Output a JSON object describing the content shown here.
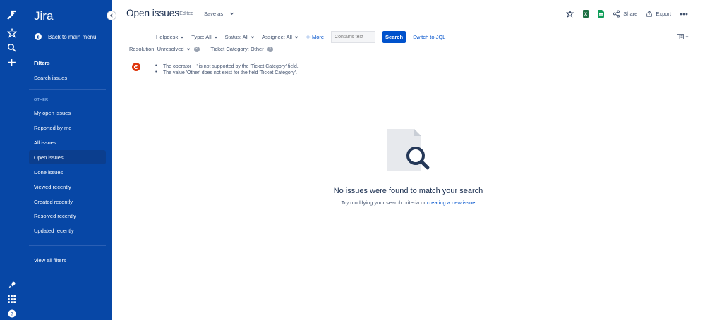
{
  "app": {
    "name": "Jira"
  },
  "sidebar": {
    "back_label": "Back to main menu",
    "filters_heading": "Filters",
    "search_issues": "Search issues",
    "section_label": "OTHER",
    "items": [
      {
        "label": "My open issues"
      },
      {
        "label": "Reported by me"
      },
      {
        "label": "All issues"
      },
      {
        "label": "Open issues"
      },
      {
        "label": "Done issues"
      },
      {
        "label": "Viewed recently"
      },
      {
        "label": "Created recently"
      },
      {
        "label": "Resolved recently"
      },
      {
        "label": "Updated recently"
      }
    ],
    "active_item": "Open issues",
    "view_all_filters": "View all filters"
  },
  "header": {
    "title": "Open issues",
    "edited": "· Edited",
    "save_as": "Save as",
    "share": "Share",
    "export": "Export"
  },
  "filters": {
    "project": "Helpdesk",
    "type": "Type: All",
    "status": "Status: All",
    "assignee": "Assignee: All",
    "more": "More",
    "text_placeholder": "Contains text",
    "search": "Search",
    "switch_jql": "Switch to JQL",
    "resolution": "Resolution: Unresolved",
    "ticket_category": "Ticket Category: Other"
  },
  "errors": [
    "The operator '~' is not supported by the 'Ticket Category' field.",
    "The value 'Other' does not exist for the field 'Ticket Category'."
  ],
  "empty_state": {
    "title": "No issues were found to match your search",
    "subtitle_prefix": "Try modifying your search criteria or",
    "subtitle_link": "creating a new issue"
  },
  "colors": {
    "sidebar": "#0747A6",
    "accent": "#0052CC",
    "error": "#DE350B"
  }
}
